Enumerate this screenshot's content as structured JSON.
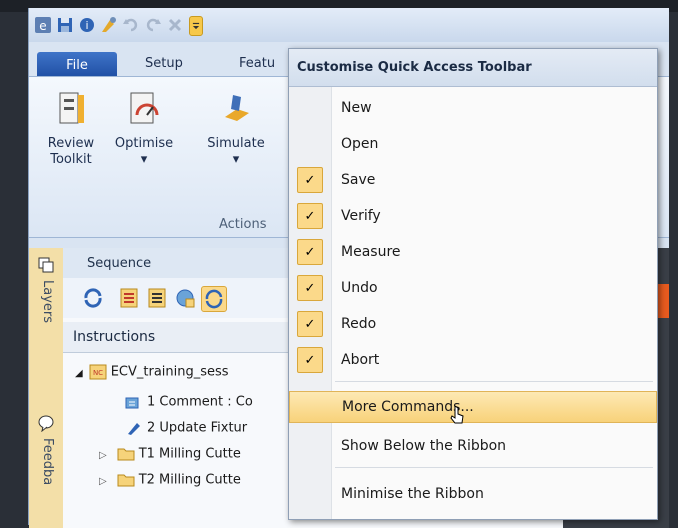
{
  "app": {
    "tabs": [
      "File",
      "Setup",
      "Featu"
    ],
    "ribbon_buttons": [
      {
        "label_line1": "Review",
        "label_line2": "Toolkit",
        "icon": "review-toolkit-icon"
      },
      {
        "label_line1": "Optimise",
        "label_line2": "▾",
        "icon": "optimise-icon"
      },
      {
        "label_line1": "Simulate",
        "label_line2": "▾",
        "icon": "simulate-icon"
      }
    ],
    "ribbon_group": "Actions",
    "sidebar_tabs": [
      "Layers",
      "Feedba"
    ],
    "sequence_title": "Sequence",
    "instructions_header": "Instructions",
    "tree": [
      "ECV_training_sess",
      "1 Comment : Co",
      "2 Update Fixtur",
      "T1 Milling Cutte",
      "T2 Milling Cutte"
    ]
  },
  "menu": {
    "title": "Customise Quick Access Toolbar",
    "items": [
      {
        "label": "New",
        "checked": false
      },
      {
        "label": "Open",
        "checked": false
      },
      {
        "label": "Save",
        "checked": true
      },
      {
        "label": "Verify",
        "checked": true
      },
      {
        "label": "Measure",
        "checked": true
      },
      {
        "label": "Undo",
        "checked": true
      },
      {
        "label": "Redo",
        "checked": true
      },
      {
        "label": "Abort",
        "checked": true
      }
    ],
    "more_commands": "More Commands...",
    "show_below": "Show Below the Ribbon",
    "minimise": "Minimise the Ribbon",
    "check_glyph": "✓"
  },
  "colors": {
    "accent": "#f8d27a",
    "file_tab": "#2b5db5",
    "check_border": "#d9a73b"
  }
}
